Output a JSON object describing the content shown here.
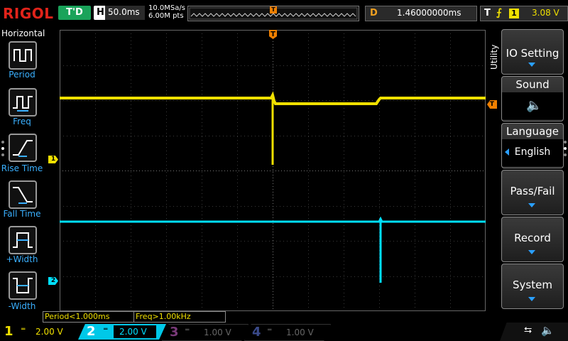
{
  "brand": "RIGOL",
  "trigger_status": "T'D",
  "horizontal": {
    "label": "H",
    "timebase": "50.0ms"
  },
  "acquisition": {
    "sample_rate": "10.0MSa/s",
    "mem_depth": "6.00M pts"
  },
  "delay": {
    "label": "D",
    "value": "1.46000000ms"
  },
  "trigger": {
    "label": "T",
    "source": "1",
    "level": "3.08 V"
  },
  "left_menu": {
    "title": "Horizontal",
    "items": [
      "Period",
      "Freq",
      "Rise Time",
      "Fall Time",
      "+Width",
      "-Width"
    ]
  },
  "right_menu": {
    "tab": "Utility",
    "items": [
      {
        "label": "IO Setting"
      },
      {
        "label": "Sound"
      },
      {
        "label": "Language",
        "value": "English"
      },
      {
        "label": "Pass/Fail"
      },
      {
        "label": "Record"
      },
      {
        "label": "System"
      }
    ]
  },
  "measurements": [
    "Period<1.000ms",
    "Freq>1.00kHz"
  ],
  "channels": [
    {
      "num": "1",
      "scale": "2.00 V",
      "color": "#f0e000",
      "active": true
    },
    {
      "num": "2",
      "scale": "2.00 V",
      "color": "#00e0ff",
      "active": true
    },
    {
      "num": "3",
      "scale": "1.00 V",
      "color": "#d040d0",
      "active": false
    },
    {
      "num": "4",
      "scale": "1.00 V",
      "color": "#3070ff",
      "active": false
    }
  ],
  "markers": {
    "ch1": "1",
    "ch2": "2",
    "trigger_level": "T",
    "trigger_pos": "T"
  },
  "colors": {
    "ch1": "#f0e000",
    "ch2": "#00e0ff",
    "trigger": "#f08000",
    "grid": "#555555"
  }
}
